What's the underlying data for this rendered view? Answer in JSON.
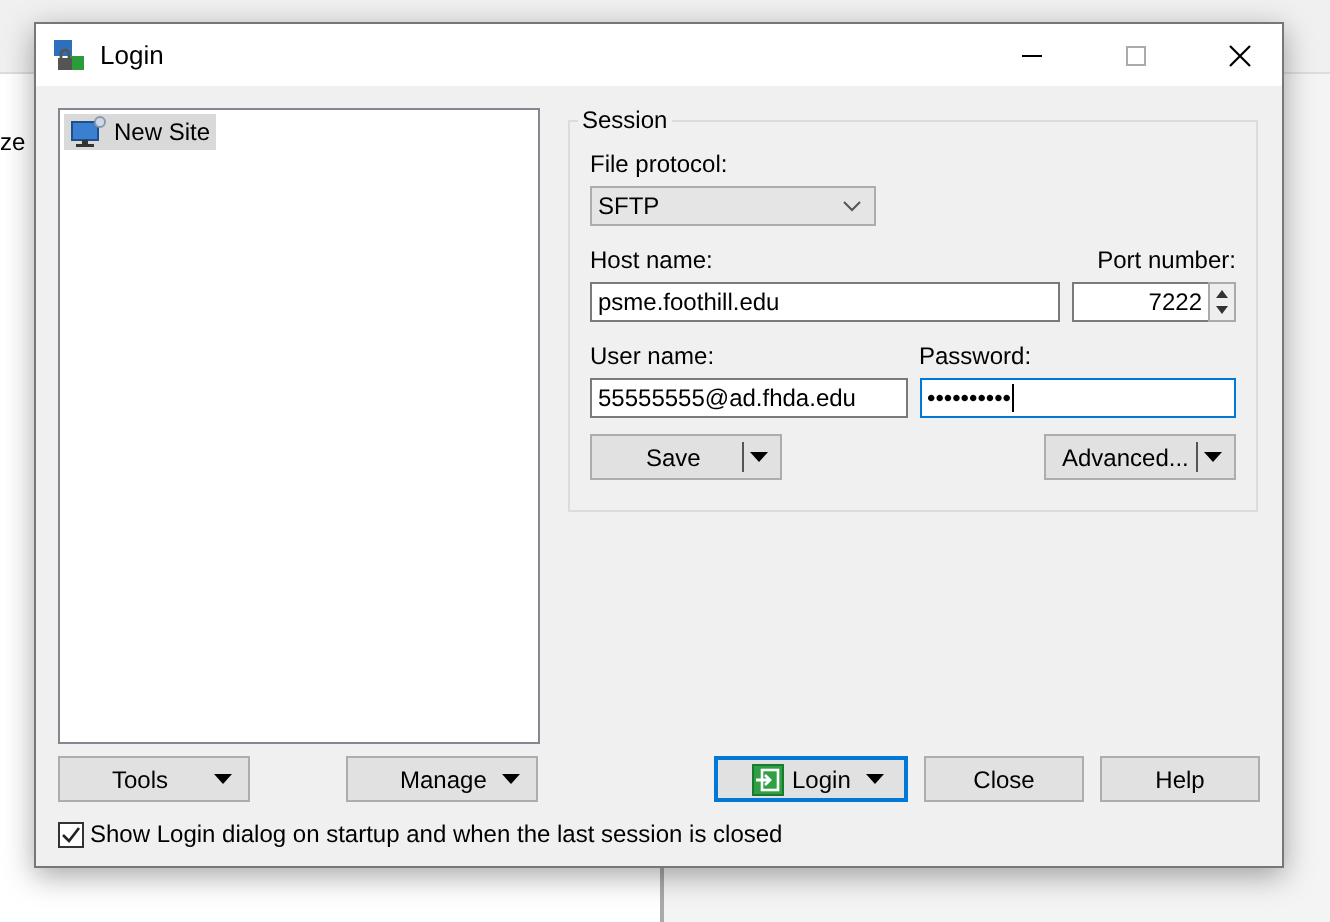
{
  "background": {
    "fragment": "ze"
  },
  "window": {
    "title": "Login"
  },
  "sites": [
    {
      "label": "New Site",
      "selected": true
    }
  ],
  "session": {
    "title": "Session",
    "protocol_label": "File protocol:",
    "protocol": "SFTP",
    "host_label": "Host name:",
    "host": "psme.foothill.edu",
    "port_label": "Port number:",
    "port": "7222",
    "user_label": "User name:",
    "user": "55555555@ad.fhda.edu",
    "password_label": "Password:",
    "password": "••••••••••",
    "save": "Save",
    "advanced": "Advanced..."
  },
  "left_buttons": [
    "Tools",
    "Manage"
  ],
  "actions": [
    {
      "label": "Login",
      "kind": "split",
      "default": true
    },
    {
      "label": "Close",
      "kind": "plain",
      "default": false
    },
    {
      "label": "Help",
      "kind": "plain",
      "default": false
    }
  ],
  "startup_option": {
    "label": "Show Login dialog on startup and when the last session is closed",
    "checked": true
  }
}
